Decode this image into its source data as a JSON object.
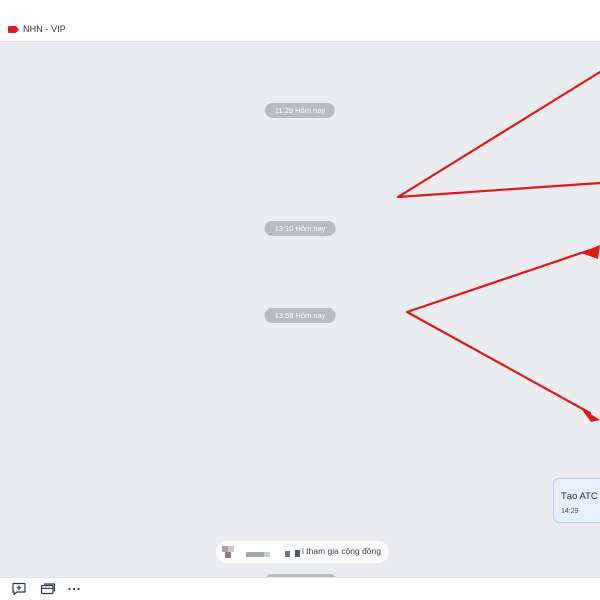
{
  "header": {
    "title": "NHN - VIP",
    "tag_icon": "tag-icon",
    "tag_color": "#d61f26"
  },
  "timeline": [
    {
      "time": "11:29 Hôm nay"
    },
    {
      "time": "13:10 Hôm nay"
    },
    {
      "time": "13:58 Hôm nay"
    }
  ],
  "message": {
    "text": "Tạo ATC r",
    "time": "14:29"
  },
  "join_notice": {
    "text": "i tham gia cộng đồng"
  },
  "annotation": {
    "color": "#e01818"
  },
  "toolbar": {
    "icons": [
      "add-message-icon",
      "card-icon",
      "more-icon"
    ]
  },
  "colors": {
    "chat_bg": "#ebecf0",
    "bubble_bg": "#e5effd",
    "bubble_border": "#b5cdf3",
    "pill_bg": "#b9bcc3"
  }
}
